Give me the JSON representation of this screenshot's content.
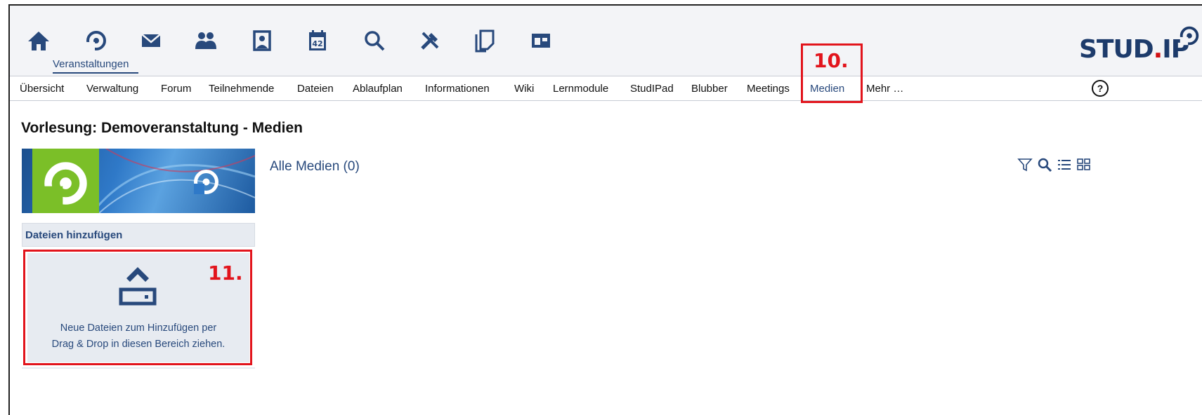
{
  "topnav": {
    "icons": [
      "home-icon",
      "courses-icon",
      "messages-icon",
      "community-icon",
      "profile-icon",
      "schedule-icon",
      "search-icon",
      "tools-icon",
      "documents-icon",
      "admin-icon"
    ],
    "active_label": "Veranstaltungen",
    "calendar_number": "42"
  },
  "logo": {
    "text_a": "STUD",
    "dot": ".",
    "text_b": "IP"
  },
  "subnav": {
    "items": [
      "Übersicht",
      "Verwaltung",
      "Forum",
      "Teilnehmende",
      "Dateien",
      "Ablaufplan",
      "Informationen",
      "Wiki",
      "Lernmodule",
      "StudIPad",
      "Blubber",
      "Meetings",
      "Medien",
      "Mehr …"
    ],
    "active": "Medien",
    "help": "?"
  },
  "annotations": {
    "label_10": "10.",
    "label_11": "11."
  },
  "main": {
    "page_title": "Vorlesung: Demoveranstaltung - Medien",
    "all_media": "Alle Medien (0)"
  },
  "sidebar": {
    "header": "Dateien hinzufügen",
    "dropzone_line1": "Neue Dateien zum Hinzufügen per",
    "dropzone_line2": "Drag & Drop in diesen Bereich ziehen."
  },
  "colors": {
    "brand_blue": "#28497c",
    "annotation_red": "#e2141c",
    "panel_bg": "#e7ebf1"
  }
}
